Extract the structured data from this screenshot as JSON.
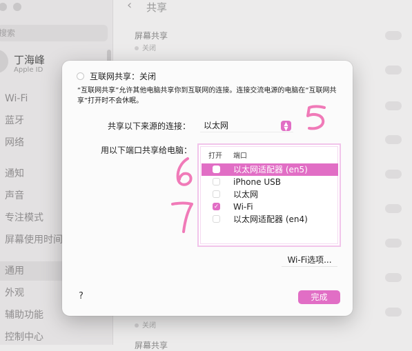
{
  "sidebar": {
    "search_placeholder": "搜索",
    "user_name": "丁海峰",
    "user_sub": "Apple ID",
    "items": [
      {
        "label": "Wi-Fi"
      },
      {
        "label": "蓝牙"
      },
      {
        "label": "网络"
      },
      {
        "label": "通知"
      },
      {
        "label": "声音"
      },
      {
        "label": "专注模式"
      },
      {
        "label": "屏幕使用时间"
      },
      {
        "label": "通用",
        "selected": true
      },
      {
        "label": "外观"
      },
      {
        "label": "辅助功能"
      },
      {
        "label": "控制中心"
      }
    ]
  },
  "main": {
    "back_label": "‹",
    "title": "共享",
    "rows": [
      {
        "title": "屏幕共享",
        "status": "关闭"
      },
      {
        "status": "关闭"
      },
      {
        "title": "屏幕共享"
      }
    ]
  },
  "dialog": {
    "service_name": "互联网共享：关闭",
    "description": "“互联网共享”允许其他电脑共享你到互联网的连接。连接交流电源的电脑在“互联网共享”打开时不会休眠。",
    "source_label": "共享以下来源的连接：",
    "source_value": "以太网",
    "select_arrows": "⌃⌄",
    "ports_label": "用以下端口共享给电脑：",
    "col_on": "打开",
    "col_port": "端口",
    "ports": [
      {
        "name": "以太网适配器 (en5)",
        "checked": false,
        "selected": true
      },
      {
        "name": "iPhone USB",
        "checked": false,
        "selected": false
      },
      {
        "name": "以太网",
        "checked": false,
        "selected": false
      },
      {
        "name": "Wi-Fi",
        "checked": true,
        "selected": false
      },
      {
        "name": "以太网适配器 (en4)",
        "checked": false,
        "selected": false
      }
    ],
    "checkmark": "✓",
    "wifi_options_label": "Wi-Fi选项...",
    "help_label": "?",
    "done_label": "完成"
  },
  "annotations": {
    "color": "#f07ab8",
    "marks": [
      "5",
      "6",
      "7"
    ]
  },
  "colors": {
    "accent": "#e16ec5",
    "dialog_bg": "#fbfbfb"
  }
}
